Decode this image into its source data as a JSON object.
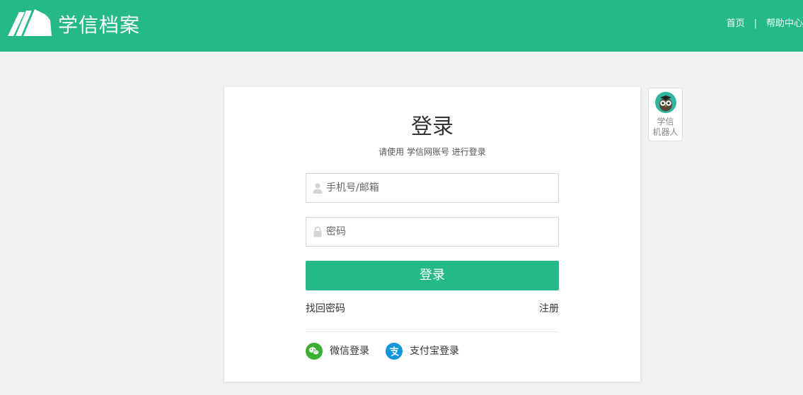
{
  "header": {
    "brand": "学信档案",
    "nav": {
      "home": "首页",
      "separator": "|",
      "help": "帮助中心"
    },
    "colors": {
      "background": "#24b986",
      "text": "#ffffff"
    }
  },
  "login": {
    "title": "登录",
    "subtitle": "请使用 学信网账号 进行登录",
    "username": {
      "placeholder": "手机号/邮箱",
      "value": "",
      "icon": "user-icon"
    },
    "password": {
      "placeholder": "密码",
      "value": "",
      "icon": "lock-icon"
    },
    "submit_label": "登录",
    "forgot_label": "找回密码",
    "register_label": "注册",
    "social": [
      {
        "label": "微信登录",
        "icon": "wechat-icon",
        "color": "#3cb034"
      },
      {
        "label": "支付宝登录",
        "icon": "alipay-icon",
        "color": "#1296db"
      }
    ]
  },
  "robot": {
    "line1": "学信",
    "line2": "机器人",
    "icon": "robot-owl-icon"
  }
}
